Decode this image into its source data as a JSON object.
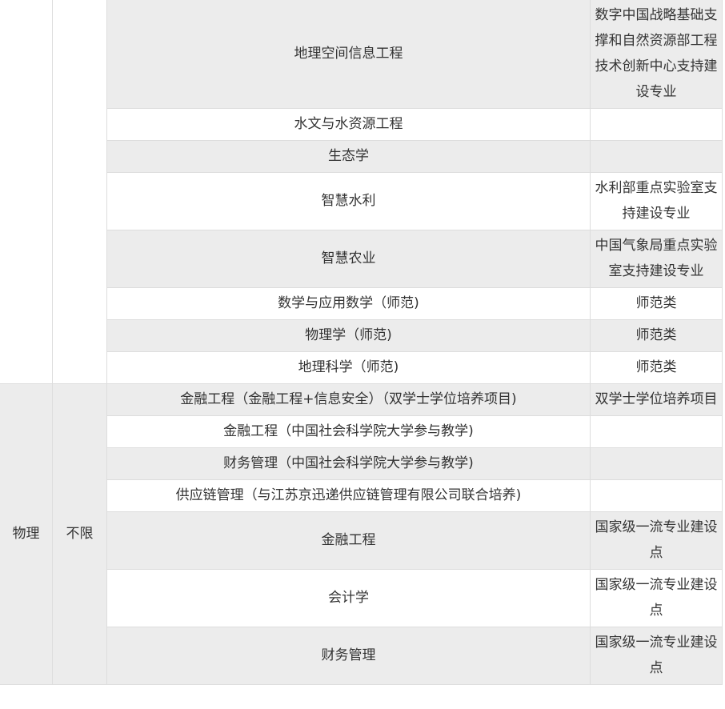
{
  "group_top": {
    "subject": "",
    "restriction": "",
    "rows": [
      {
        "major": "地理空间信息工程",
        "note": "数字中国战略基础支撑和自然资源部工程技术创新中心支持建设专业"
      },
      {
        "major": "水文与水资源工程",
        "note": ""
      },
      {
        "major": "生态学",
        "note": ""
      },
      {
        "major": "智慧水利",
        "note": "水利部重点实验室支持建设专业"
      },
      {
        "major": "智慧农业",
        "note": "中国气象局重点实验室支持建设专业"
      },
      {
        "major": "数学与应用数学（师范)",
        "note": "师范类"
      },
      {
        "major": "物理学（师范)",
        "note": "师范类"
      },
      {
        "major": "地理科学（师范)",
        "note": "师范类"
      }
    ]
  },
  "group_bottom": {
    "subject": "物理",
    "restriction": "不限",
    "rows": [
      {
        "major": "金融工程（金融工程+信息安全）（双学士学位培养项目)",
        "note": "双学士学位培养项目"
      },
      {
        "major": "金融工程（中国社会科学院大学参与教学)",
        "note": ""
      },
      {
        "major": "财务管理（中国社会科学院大学参与教学)",
        "note": ""
      },
      {
        "major": "供应链管理（与江苏京迅递供应链管理有限公司联合培养)",
        "note": ""
      },
      {
        "major": "金融工程",
        "note": "国家级一流专业建设点"
      },
      {
        "major": "会计学",
        "note": "国家级一流专业建设点"
      },
      {
        "major": "财务管理",
        "note": "国家级一流专业建设点"
      }
    ]
  }
}
